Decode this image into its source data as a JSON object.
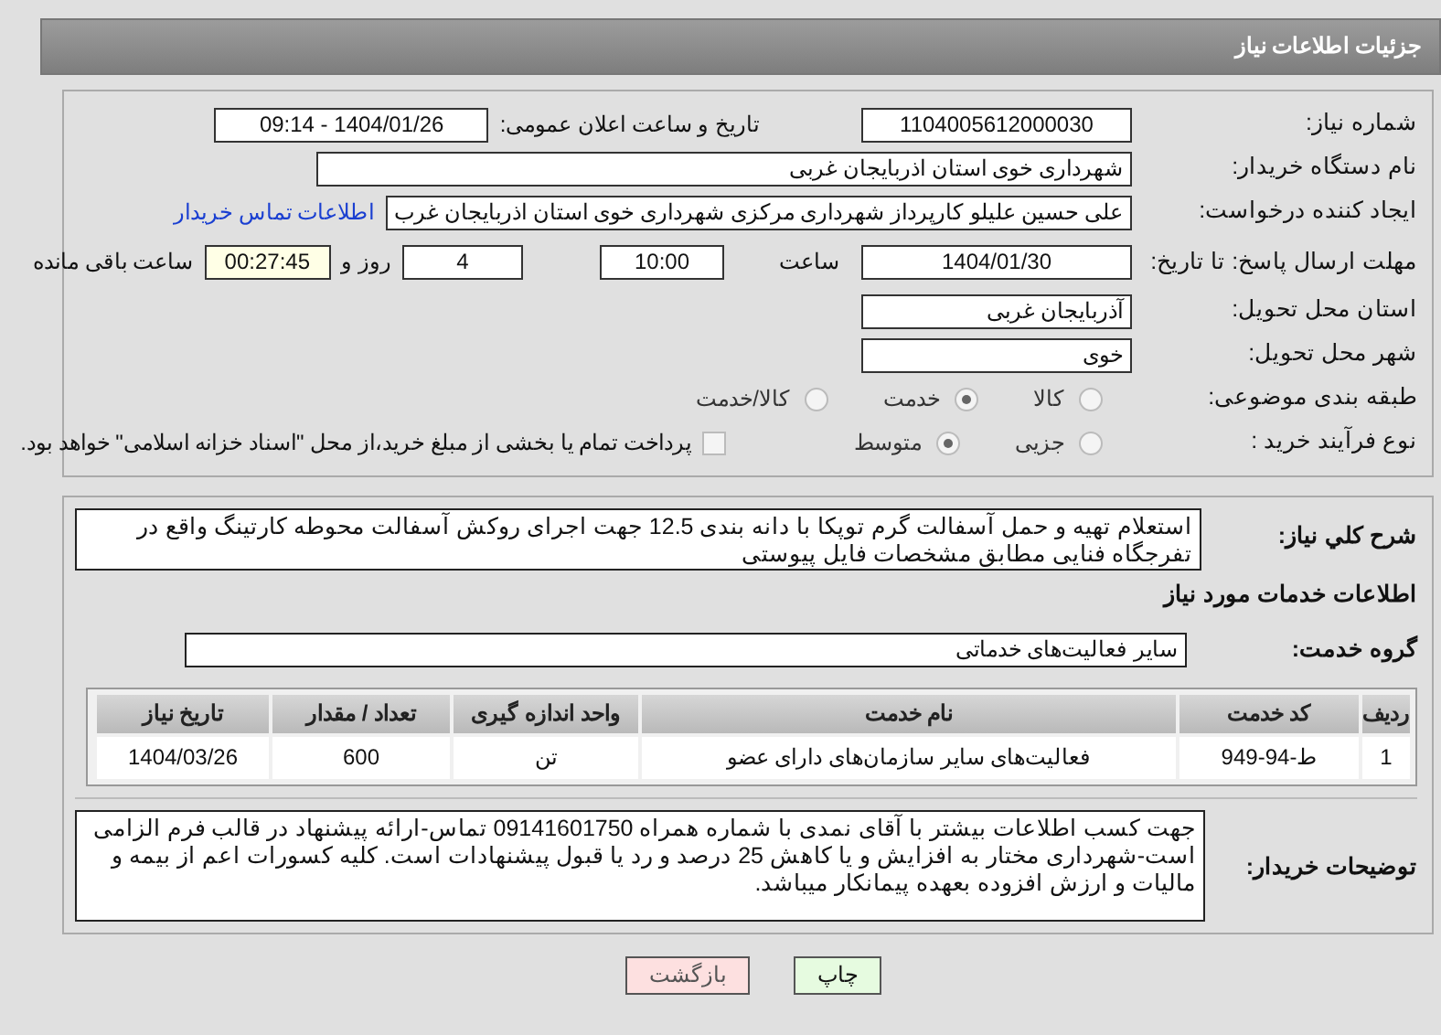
{
  "header": {
    "title": "جزئیات اطلاعات نیاز"
  },
  "need_number": {
    "label": "شماره نیاز:",
    "value": "1104005612000030"
  },
  "announce_date": {
    "label": "تاریخ و ساعت اعلان عمومی:",
    "value": "1404/01/26 - 09:14"
  },
  "buyer_org": {
    "label": "نام دستگاه خریدار:",
    "value": "شهرداری خوی استان اذربایجان غربی"
  },
  "requester": {
    "label": "ایجاد کننده درخواست:",
    "value": "علی حسین علیلو کارپرداز شهرداری مرکزی شهرداری خوی استان اذربایجان غرب",
    "link": "اطلاعات تماس خریدار"
  },
  "deadline": {
    "label": "مهلت ارسال پاسخ: تا تاریخ:",
    "date": "1404/01/30",
    "time_label": "ساعت",
    "time": "10:00",
    "days": "4",
    "days_label": "روز و",
    "remaining": "00:27:45",
    "remaining_label": "ساعت باقی مانده"
  },
  "province": {
    "label": "استان محل تحویل:",
    "value": "آذربایجان غربی"
  },
  "city": {
    "label": "شهر محل تحویل:",
    "value": "خوی"
  },
  "category": {
    "label": "طبقه بندی موضوعی:",
    "options": [
      {
        "label": "کالا",
        "selected": false
      },
      {
        "label": "خدمت",
        "selected": true
      },
      {
        "label": "کالا/خدمت",
        "selected": false
      }
    ]
  },
  "purchase_type": {
    "label": "نوع فرآیند خرید :",
    "options": [
      {
        "label": "جزیی",
        "selected": false
      },
      {
        "label": "متوسط",
        "selected": true
      }
    ],
    "payment_note": {
      "label": "پرداخت تمام یا بخشی از مبلغ خرید،از محل \"اسناد خزانه اسلامی\" خواهد بود.",
      "checked": false
    }
  },
  "summary": {
    "label": "شرح كلي نياز:",
    "value": "استعلام تهیه و حمل آسفالت گرم توپکا با دانه بندی 12.5 جهت اجرای روکش آسفالت محوطه کارتینگ واقع در تفرجگاه فنایی مطابق مشخصات فایل پیوستی"
  },
  "services_heading": "اطلاعات خدمات مورد نیاز",
  "service_group": {
    "label": "گروه خدمت:",
    "value": "سایر فعالیت‌های خدماتی"
  },
  "table": {
    "columns": [
      "ردیف",
      "کد خدمت",
      "نام خدمت",
      "واحد اندازه گیری",
      "تعداد / مقدار",
      "تاریخ نیاز"
    ],
    "rows": [
      [
        "1",
        "ط-94-949",
        "فعالیت‌های سایر سازمان‌های دارای عضو",
        "تن",
        "600",
        "1404/03/26"
      ]
    ]
  },
  "buyer_notes": {
    "label": "توضیحات خریدار:",
    "value": "جهت کسب اطلاعات بیشتر با آقای نمدی با شماره همراه 09141601750 تماس-ارائه پیشنهاد در قالب فرم الزامی است-شهرداری مختار به افزایش و یا کاهش 25 درصد و رد یا قبول پیشنهادات است. کلیه کسورات اعم از بیمه و مالیات و ارزش افزوده بعهده پیمانکار میباشد."
  },
  "buttons": [
    {
      "kind": "print",
      "label": "چاپ"
    },
    {
      "kind": "back",
      "label": "بازگشت"
    }
  ]
}
